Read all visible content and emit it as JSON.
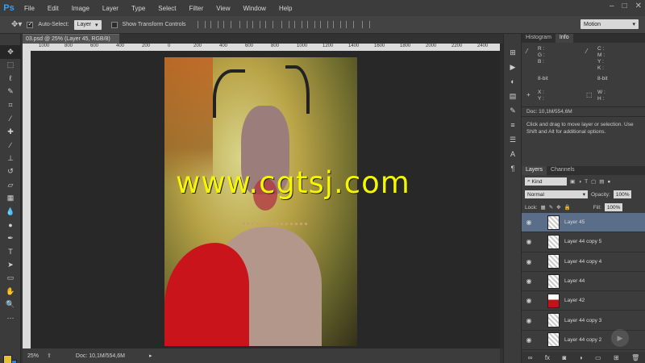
{
  "app": {
    "logo": "Ps"
  },
  "menu": [
    "File",
    "Edit",
    "Image",
    "Layer",
    "Type",
    "Select",
    "Filter",
    "View",
    "Window",
    "Help"
  ],
  "window_controls": [
    "–",
    "□",
    "✕"
  ],
  "options": {
    "auto_select_label": "Auto-Select:",
    "auto_select_value": "Layer",
    "transform_label": "Show Transform Controls",
    "workspace": "Motion"
  },
  "document": {
    "tab": "03.psd @ 25% (Layer 45, RGB/8)",
    "zoom": "25%",
    "doc_size": "Doc: 10,1M/554,6M"
  },
  "ruler": [
    "1000",
    "800",
    "600",
    "400",
    "200",
    "0",
    "200",
    "400",
    "600",
    "800",
    "1000",
    "1200",
    "1400",
    "1600",
    "1800",
    "2000",
    "2200",
    "2400"
  ],
  "watermark": "www.cgtsj.com",
  "info_panel": {
    "tabs": [
      "Histogram",
      "Info"
    ],
    "rgb": "R :\nG :\nB :",
    "cmyk": "C :\nM :\nY :\nK :",
    "bit_left": "8-bit",
    "bit_right": "8-bit",
    "xy": "X :\nY :",
    "wh": "W :\nH :",
    "doc": "Doc: 10,1M/554,6M",
    "hint": "Click and drag to move layer or selection.  Use Shift and Alt for additional options."
  },
  "layers_panel": {
    "tabs": [
      "Layers",
      "Channels"
    ],
    "filter": "Kind",
    "blend_mode": "Normal",
    "opacity_label": "Opacity:",
    "opacity": "100%",
    "lock_label": "Lock:",
    "fill_label": "Fill:",
    "fill": "100%",
    "layers": [
      {
        "name": "Layer 45",
        "selected": true
      },
      {
        "name": "Layer 44 copy 5",
        "selected": false
      },
      {
        "name": "Layer 44 copy 4",
        "selected": false
      },
      {
        "name": "Layer 44",
        "selected": false
      },
      {
        "name": "Layer 42",
        "selected": false
      },
      {
        "name": "Layer 44 copy 3",
        "selected": false
      },
      {
        "name": "Layer 44 copy 2",
        "selected": false
      }
    ],
    "footer_icons": [
      "link-icon",
      "fx-icon",
      "mask-icon",
      "adjustment-icon",
      "group-icon",
      "new-layer-icon",
      "trash-icon"
    ]
  },
  "colors": {
    "foreground": "#e3c23a",
    "background": "#2f7fdc",
    "accent": "#2fa3ff",
    "watermark": "#f6f600"
  }
}
